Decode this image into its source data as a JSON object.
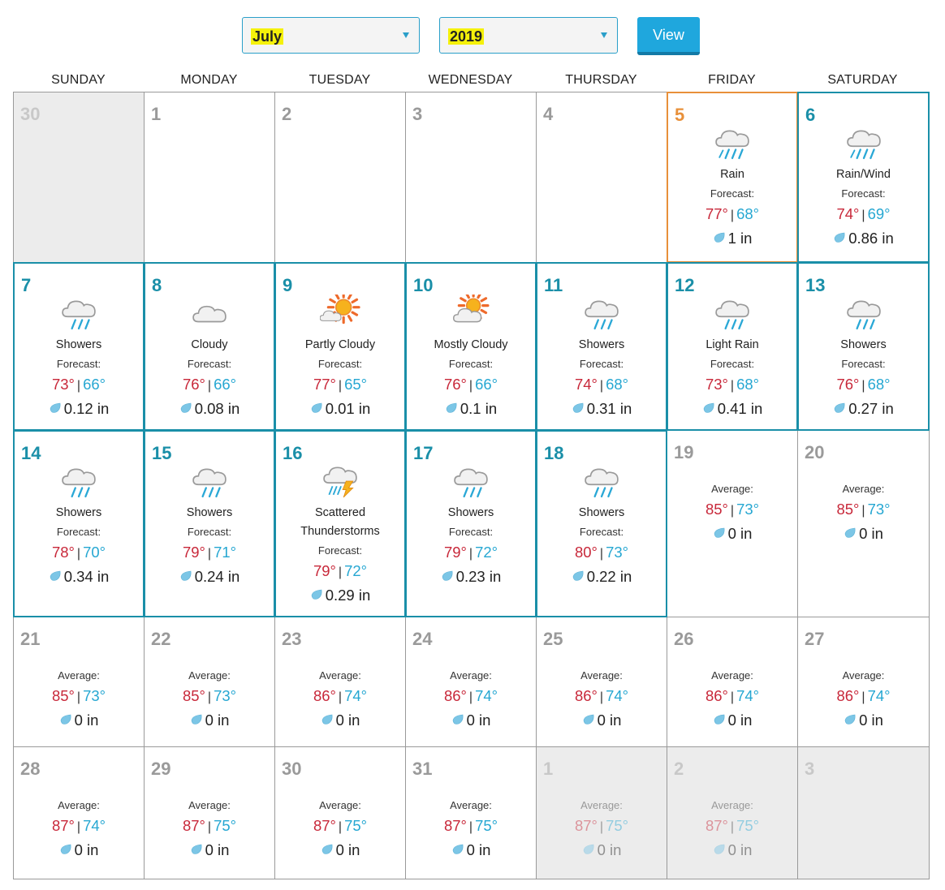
{
  "controls": {
    "month": "July",
    "year": "2019",
    "view_label": "View"
  },
  "days_of_week": [
    "SUNDAY",
    "MONDAY",
    "TUESDAY",
    "WEDNESDAY",
    "THURSDAY",
    "FRIDAY",
    "SATURDAY"
  ],
  "colors": {
    "accent": "#1fa7dd",
    "forecast_border": "#1a8fa8",
    "today_border": "#e8903a",
    "high_temp": "#c8283a",
    "low_temp": "#26a7d2"
  },
  "weeks": [
    [
      {
        "day": "30",
        "state": "outside"
      },
      {
        "day": "1",
        "state": "empty"
      },
      {
        "day": "2",
        "state": "empty"
      },
      {
        "day": "3",
        "state": "empty"
      },
      {
        "day": "4",
        "state": "empty"
      },
      {
        "day": "5",
        "state": "today",
        "icon": "rain-icon",
        "condition": "Rain",
        "label": "Forecast:",
        "hi": "77°",
        "lo": "68°",
        "precip": "1 in"
      },
      {
        "day": "6",
        "state": "forecast",
        "icon": "rain-wind-icon",
        "condition": "Rain/Wind",
        "label": "Forecast:",
        "hi": "74°",
        "lo": "69°",
        "precip": "0.86 in"
      }
    ],
    [
      {
        "day": "7",
        "state": "forecast",
        "icon": "showers-icon",
        "condition": "Showers",
        "label": "Forecast:",
        "hi": "73°",
        "lo": "66°",
        "precip": "0.12 in"
      },
      {
        "day": "8",
        "state": "forecast",
        "icon": "cloudy-icon",
        "condition": "Cloudy",
        "label": "Forecast:",
        "hi": "76°",
        "lo": "66°",
        "precip": "0.08 in"
      },
      {
        "day": "9",
        "state": "forecast",
        "icon": "partly-cloudy-icon",
        "condition": "Partly Cloudy",
        "label": "Forecast:",
        "hi": "77°",
        "lo": "65°",
        "precip": "0.01 in"
      },
      {
        "day": "10",
        "state": "forecast",
        "icon": "mostly-cloudy-icon",
        "condition": "Mostly Cloudy",
        "label": "Forecast:",
        "hi": "76°",
        "lo": "66°",
        "precip": "0.1 in"
      },
      {
        "day": "11",
        "state": "forecast",
        "icon": "showers-icon",
        "condition": "Showers",
        "label": "Forecast:",
        "hi": "74°",
        "lo": "68°",
        "precip": "0.31 in"
      },
      {
        "day": "12",
        "state": "forecast",
        "icon": "light-rain-icon",
        "condition": "Light Rain",
        "label": "Forecast:",
        "hi": "73°",
        "lo": "68°",
        "precip": "0.41 in"
      },
      {
        "day": "13",
        "state": "forecast",
        "icon": "showers-icon",
        "condition": "Showers",
        "label": "Forecast:",
        "hi": "76°",
        "lo": "68°",
        "precip": "0.27 in"
      }
    ],
    [
      {
        "day": "14",
        "state": "forecast",
        "icon": "showers-icon",
        "condition": "Showers",
        "label": "Forecast:",
        "hi": "78°",
        "lo": "70°",
        "precip": "0.34 in"
      },
      {
        "day": "15",
        "state": "forecast",
        "icon": "showers-icon",
        "condition": "Showers",
        "label": "Forecast:",
        "hi": "79°",
        "lo": "71°",
        "precip": "0.24 in"
      },
      {
        "day": "16",
        "state": "forecast",
        "icon": "thunderstorm-icon",
        "condition": "Scattered Thunderstorms",
        "label": "Forecast:",
        "hi": "79°",
        "lo": "72°",
        "precip": "0.29 in"
      },
      {
        "day": "17",
        "state": "forecast",
        "icon": "showers-icon",
        "condition": "Showers",
        "label": "Forecast:",
        "hi": "79°",
        "lo": "72°",
        "precip": "0.23 in"
      },
      {
        "day": "18",
        "state": "forecast",
        "icon": "showers-icon",
        "condition": "Showers",
        "label": "Forecast:",
        "hi": "80°",
        "lo": "73°",
        "precip": "0.22 in"
      },
      {
        "day": "19",
        "state": "average",
        "label": "Average:",
        "hi": "85°",
        "lo": "73°",
        "precip": "0 in"
      },
      {
        "day": "20",
        "state": "average",
        "label": "Average:",
        "hi": "85°",
        "lo": "73°",
        "precip": "0 in"
      }
    ],
    [
      {
        "day": "21",
        "state": "average",
        "label": "Average:",
        "hi": "85°",
        "lo": "73°",
        "precip": "0 in"
      },
      {
        "day": "22",
        "state": "average",
        "label": "Average:",
        "hi": "85°",
        "lo": "73°",
        "precip": "0 in"
      },
      {
        "day": "23",
        "state": "average",
        "label": "Average:",
        "hi": "86°",
        "lo": "74°",
        "precip": "0 in"
      },
      {
        "day": "24",
        "state": "average",
        "label": "Average:",
        "hi": "86°",
        "lo": "74°",
        "precip": "0 in"
      },
      {
        "day": "25",
        "state": "average",
        "label": "Average:",
        "hi": "86°",
        "lo": "74°",
        "precip": "0 in"
      },
      {
        "day": "26",
        "state": "average",
        "label": "Average:",
        "hi": "86°",
        "lo": "74°",
        "precip": "0 in"
      },
      {
        "day": "27",
        "state": "average",
        "label": "Average:",
        "hi": "86°",
        "lo": "74°",
        "precip": "0 in"
      }
    ],
    [
      {
        "day": "28",
        "state": "average",
        "label": "Average:",
        "hi": "87°",
        "lo": "74°",
        "precip": "0 in"
      },
      {
        "day": "29",
        "state": "average",
        "label": "Average:",
        "hi": "87°",
        "lo": "75°",
        "precip": "0 in"
      },
      {
        "day": "30",
        "state": "average",
        "label": "Average:",
        "hi": "87°",
        "lo": "75°",
        "precip": "0 in"
      },
      {
        "day": "31",
        "state": "average",
        "label": "Average:",
        "hi": "87°",
        "lo": "75°",
        "precip": "0 in"
      },
      {
        "day": "1",
        "state": "outside-average",
        "label": "Average:",
        "hi": "87°",
        "lo": "75°",
        "precip": "0 in"
      },
      {
        "day": "2",
        "state": "outside-average",
        "label": "Average:",
        "hi": "87°",
        "lo": "75°",
        "precip": "0 in"
      },
      {
        "day": "3",
        "state": "outside"
      }
    ]
  ]
}
